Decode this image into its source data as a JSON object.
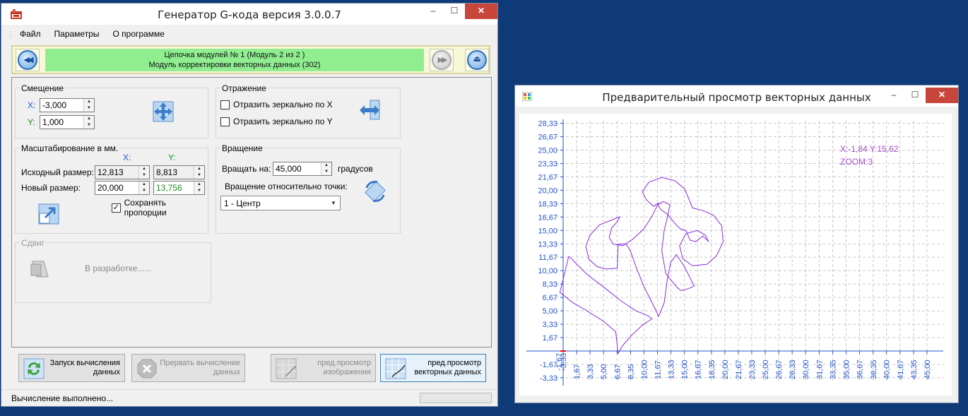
{
  "main_window": {
    "title": "Генератор G-кода версия 3.0.0.7",
    "controls": {
      "minimize": "–",
      "maximize": "☐",
      "close": "✕"
    }
  },
  "menu": {
    "items": [
      "Файл",
      "Параметры",
      "О программе"
    ]
  },
  "nav": {
    "line1": "Цепочка модулей № 1 (Модуль 2 из 2 )",
    "line2": "Модуль корректировки векторных данных (302)",
    "prev_icon": "rewind-icon",
    "next_icon": "fast-forward-icon",
    "eject_icon": "eject-icon"
  },
  "offset": {
    "legend": "Смещение",
    "x_label": "X:",
    "x_value": "-3,000",
    "y_label": "Y:",
    "y_value": "1,000",
    "icon": "move-arrows-icon"
  },
  "mirror": {
    "legend": "Отражение",
    "mirror_x": "Отразить зеркально по X",
    "mirror_y": "Отразить зеркально по Y",
    "mirror_x_checked": false,
    "mirror_y_checked": false,
    "icon": "mirror-icon"
  },
  "scale": {
    "legend": "Масштабирование в мм.",
    "col_x": "X:",
    "col_y": "Y:",
    "orig_label": "Исходный размер:",
    "orig_x": "12,813",
    "orig_y": "8,813",
    "new_label": "Новый размер:",
    "new_x": "20,000",
    "new_y": "13,756",
    "keep_label": "Сохранять пропорции",
    "keep_checked": true,
    "icon": "resize-icon"
  },
  "rotate": {
    "legend": "Вращение",
    "rotate_label": "Вращать на:",
    "rotate_value": "45,000",
    "units": "градусов",
    "point_label": "Вращение относительно точки:",
    "point_value": "1 - Центр",
    "icon": "rotate-icon"
  },
  "shift": {
    "legend": "Сдвиг",
    "placeholder": "В разработке......",
    "icon": "shear-icon"
  },
  "buttons": {
    "start": {
      "line1": "Запуск вычисления",
      "line2": "данных"
    },
    "stop": {
      "line1": "Прервать вычисление",
      "line2": "данных"
    },
    "preview_image": {
      "line1": "пред.просмотр",
      "line2": "изображения"
    },
    "preview_vector": {
      "line1": "пред.просмотр",
      "line2": "векторных данных"
    }
  },
  "status": {
    "message": "Вычисление выполнено..."
  },
  "preview_window": {
    "title": "Предварительный просмотр векторных данных",
    "coords": "X:-1,84 Y:15,62",
    "zoom": "ZOOM:3",
    "controls": {
      "minimize": "–",
      "maximize": "☐",
      "close": "✕"
    }
  },
  "colors": {
    "axis": "#2255cc",
    "grid": "#c8c8c8",
    "shape": "#8a2be2",
    "info": "#a24fc8",
    "nav_green": "#90ee90",
    "close_red": "#c7463c"
  },
  "chart_data": {
    "type": "line",
    "title": "",
    "y_ticks": [
      "28,33",
      "26,67",
      "25,00",
      "23,33",
      "21,67",
      "20,00",
      "18,33",
      "16,67",
      "15,00",
      "13,33",
      "11,67",
      "10,00",
      "8,33",
      "6,67",
      "5,00",
      "3,33",
      "1,67",
      "-1,67",
      "-3,33"
    ],
    "x_ticks": [
      "1,67",
      "3,33",
      "5,00",
      "6,67",
      "8,35",
      "10,00",
      "11,67",
      "13,33",
      "15,00",
      "16,67",
      "18,35",
      "20,00",
      "21,67",
      "23,33",
      "25,00",
      "26,67",
      "28,33",
      "30,00",
      "31,67",
      "33,35",
      "35,00",
      "36,67",
      "38,35",
      "40,00",
      "41,67",
      "43,35",
      "45,00"
    ],
    "origin_labels": [
      "-1,67",
      "-3,33"
    ],
    "xlim": [
      -3.33,
      46.67
    ],
    "ylim": [
      -3.33,
      30.0
    ],
    "grid": true,
    "series": [
      {
        "values": [
          [
            0.7,
            11.8
          ],
          [
            3.0,
            9.5
          ],
          [
            5.2,
            7.8
          ],
          [
            7.2,
            6.2
          ],
          [
            9.0,
            5.0
          ],
          [
            10.5,
            4.4
          ],
          [
            11.0,
            4.0
          ],
          [
            9.9,
            3.3
          ],
          [
            8.5,
            2.0
          ],
          [
            7.3,
            0.6
          ],
          [
            6.8,
            -0.3
          ],
          [
            6.5,
            2.4
          ],
          [
            5.0,
            3.7
          ],
          [
            2.8,
            5.1
          ],
          [
            1.2,
            6.0
          ],
          [
            -0.4,
            7.3
          ],
          [
            0.7,
            11.8
          ]
        ]
      },
      {
        "values": [
          [
            6.8,
            13.3
          ],
          [
            7.8,
            13.3
          ],
          [
            8.3,
            12.5
          ],
          [
            9.0,
            10.5
          ],
          [
            10.0,
            8.0
          ],
          [
            11.5,
            5.0
          ],
          [
            11.8,
            4.3
          ],
          [
            12.5,
            6.0
          ],
          [
            12.9,
            9.0
          ],
          [
            13.3,
            11.0
          ],
          [
            14.0,
            12.0
          ],
          [
            15.0,
            10.5
          ],
          [
            16.2,
            8.1
          ],
          [
            15.6,
            7.8
          ],
          [
            14.6,
            7.5
          ],
          [
            14.2,
            7.8
          ],
          [
            12.7,
            9.6
          ],
          [
            12.2,
            12.5
          ],
          [
            12.5,
            15.0
          ],
          [
            12.9,
            16.6
          ],
          [
            13.2,
            18.2
          ],
          [
            12.4,
            18.6
          ],
          [
            11.7,
            18.2
          ],
          [
            12.1,
            17.6
          ],
          [
            12.9,
            17.0
          ],
          [
            13.9,
            15.8
          ],
          [
            14.5,
            15.2
          ],
          [
            15.2,
            15.0
          ],
          [
            15.7,
            13.8
          ],
          [
            16.4,
            13.6
          ],
          [
            17.3,
            14.3
          ],
          [
            18.0,
            13.6
          ],
          [
            17.6,
            14.4
          ],
          [
            16.6,
            15.0
          ],
          [
            15.2,
            14.6
          ],
          [
            14.4,
            13.1
          ],
          [
            14.8,
            11.5
          ],
          [
            16.0,
            10.6
          ],
          [
            17.8,
            10.8
          ],
          [
            19.0,
            11.9
          ],
          [
            19.8,
            13.6
          ],
          [
            19.6,
            15.6
          ],
          [
            18.6,
            16.9
          ],
          [
            17.2,
            17.5
          ],
          [
            16.0,
            17.8
          ],
          [
            15.6,
            18.8
          ],
          [
            15.0,
            20.2
          ],
          [
            13.8,
            21.2
          ],
          [
            12.2,
            21.6
          ],
          [
            10.6,
            21.0
          ],
          [
            9.8,
            19.8
          ],
          [
            10.3,
            18.8
          ],
          [
            11.2,
            18.0
          ],
          [
            11.8,
            18.4
          ],
          [
            11.0,
            16.8
          ],
          [
            10.0,
            15.2
          ],
          [
            8.6,
            13.9
          ],
          [
            7.4,
            13.1
          ],
          [
            6.2,
            13.3
          ],
          [
            5.7,
            14.1
          ],
          [
            6.0,
            15.3
          ],
          [
            6.7,
            16.1
          ],
          [
            7.0,
            16.7
          ],
          [
            6.0,
            16.3
          ],
          [
            4.5,
            15.7
          ],
          [
            3.3,
            14.4
          ],
          [
            2.8,
            13.0
          ],
          [
            3.2,
            11.4
          ],
          [
            4.2,
            10.5
          ],
          [
            5.3,
            10.2
          ],
          [
            6.7,
            10.3
          ],
          [
            6.8,
            13.3
          ]
        ]
      }
    ]
  }
}
